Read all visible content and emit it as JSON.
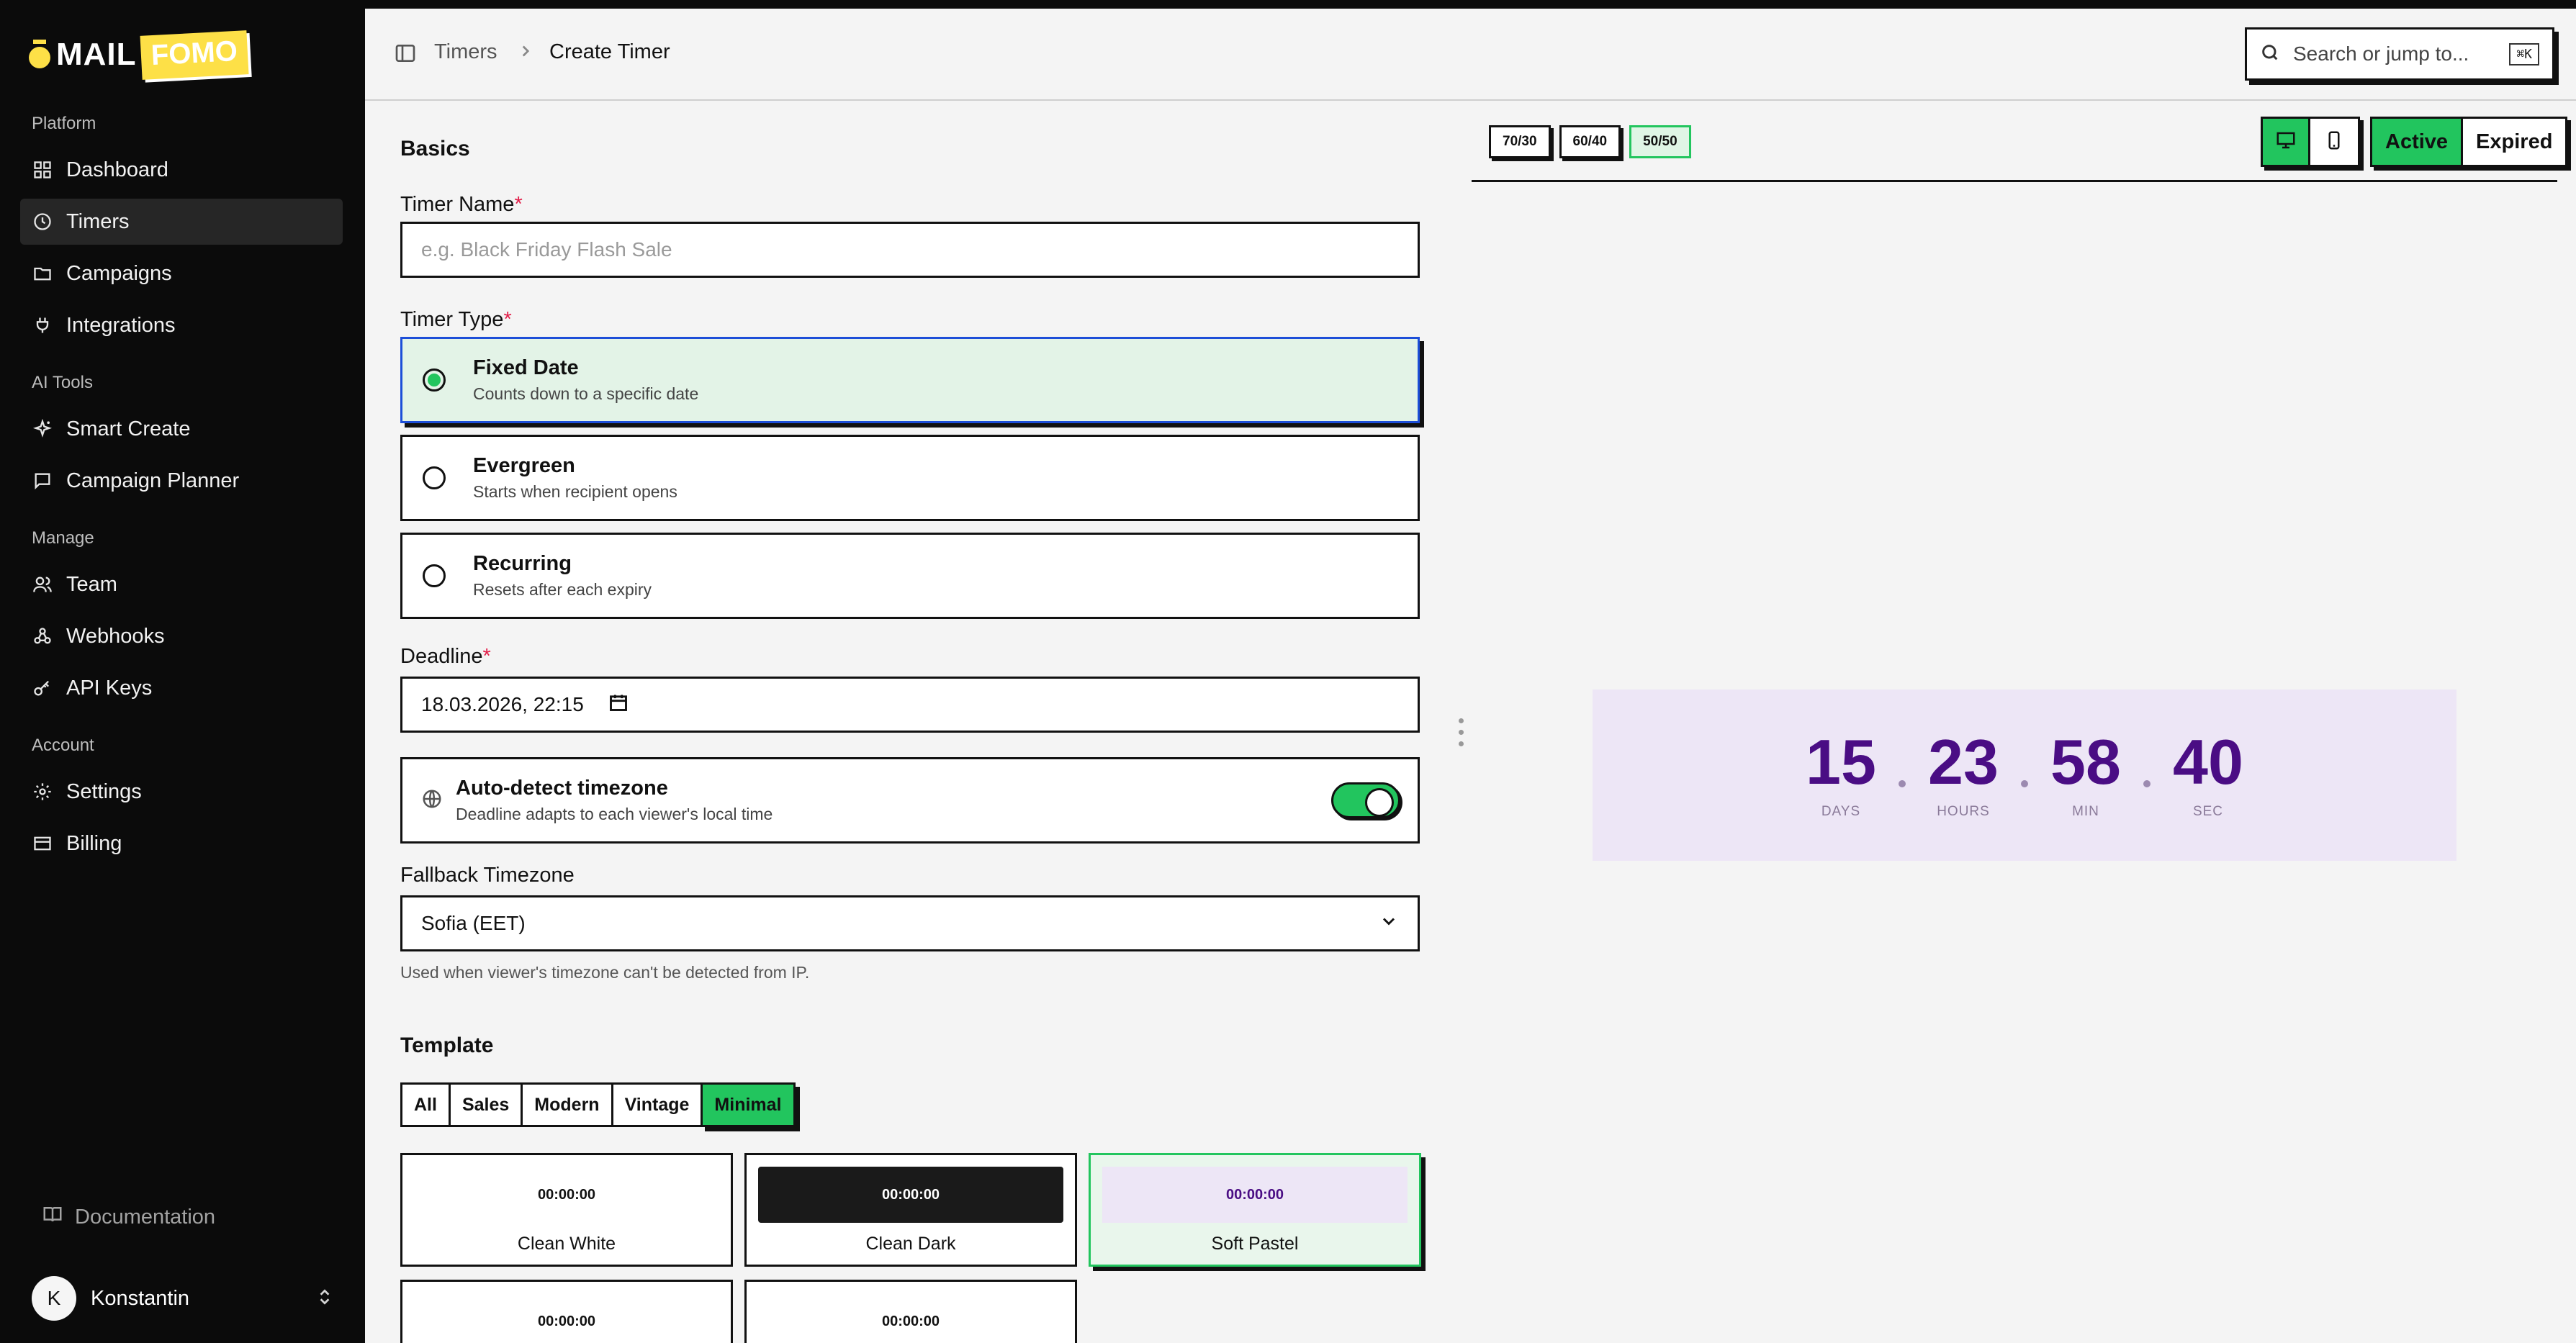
{
  "brand": {
    "part1": "MAIL",
    "part2": "FOMO"
  },
  "sidebar": {
    "sections": [
      "Platform",
      "AI Tools",
      "Manage",
      "Account"
    ],
    "items": [
      {
        "label": "Dashboard",
        "icon": "grid-icon"
      },
      {
        "label": "Timers",
        "icon": "clock-icon",
        "active": true
      },
      {
        "label": "Campaigns",
        "icon": "folder-icon"
      },
      {
        "label": "Integrations",
        "icon": "plug-icon"
      },
      {
        "label": "Smart Create",
        "icon": "sparkles-icon"
      },
      {
        "label": "Campaign Planner",
        "icon": "message-square-icon"
      },
      {
        "label": "Team",
        "icon": "users-icon"
      },
      {
        "label": "Webhooks",
        "icon": "webhook-icon"
      },
      {
        "label": "API Keys",
        "icon": "key-icon"
      },
      {
        "label": "Settings",
        "icon": "gear-icon"
      },
      {
        "label": "Billing",
        "icon": "credit-card-icon"
      }
    ],
    "docs": "Documentation",
    "user": {
      "initial": "K",
      "name": "Konstantin"
    }
  },
  "header": {
    "breadcrumb": [
      "Timers",
      "Create Timer"
    ],
    "search_placeholder": "Search or jump to...",
    "search_shortcut": "⌘K"
  },
  "form": {
    "basics_title": "Basics",
    "timer_name_label": "Timer Name",
    "timer_name_placeholder": "e.g. Black Friday Flash Sale",
    "required_mark": "*",
    "timer_type_label": "Timer Type",
    "timer_types": [
      {
        "title": "Fixed Date",
        "desc": "Counts down to a specific date",
        "selected": true
      },
      {
        "title": "Evergreen",
        "desc": "Starts when recipient opens"
      },
      {
        "title": "Recurring",
        "desc": "Resets after each expiry"
      }
    ],
    "deadline_label": "Deadline",
    "deadline_value": "18.03.2026, 22:15",
    "autodetect_title": "Auto-detect timezone",
    "autodetect_desc": "Deadline adapts to each viewer's local time",
    "autodetect_on": true,
    "fallback_label": "Fallback Timezone",
    "fallback_value": "Sofia (EET)",
    "fallback_helper": "Used when viewer's timezone can't be detected from IP.",
    "template_title": "Template",
    "template_filters": [
      "All",
      "Sales",
      "Modern",
      "Vintage",
      "Minimal"
    ],
    "template_filter_active": "Minimal",
    "templates": [
      {
        "name": "Clean White",
        "preview": "00:00:00"
      },
      {
        "name": "Clean Dark",
        "preview": "00:00:00"
      },
      {
        "name": "Soft Pastel",
        "preview": "00:00:00",
        "selected": true
      },
      {
        "name": "",
        "preview": "00:00:00"
      },
      {
        "name": "",
        "preview": "00:00:00"
      }
    ]
  },
  "preview": {
    "ratios": [
      "70/30",
      "60/40",
      "50/50"
    ],
    "ratio_active": "50/50",
    "state_active": "Active",
    "state_expired": "Expired",
    "timer": {
      "days": "15",
      "hours": "23",
      "min": "58",
      "sec": "40",
      "days_label": "DAYS",
      "hours_label": "HOURS",
      "min_label": "MIN",
      "sec_label": "SEC"
    }
  },
  "colors": {
    "accent_green": "#22c55e",
    "brand_yellow": "#fde047",
    "timer_purple": "#4a0d84",
    "required_red": "#e11d48",
    "sidebar_bg": "#0b0b0b"
  }
}
